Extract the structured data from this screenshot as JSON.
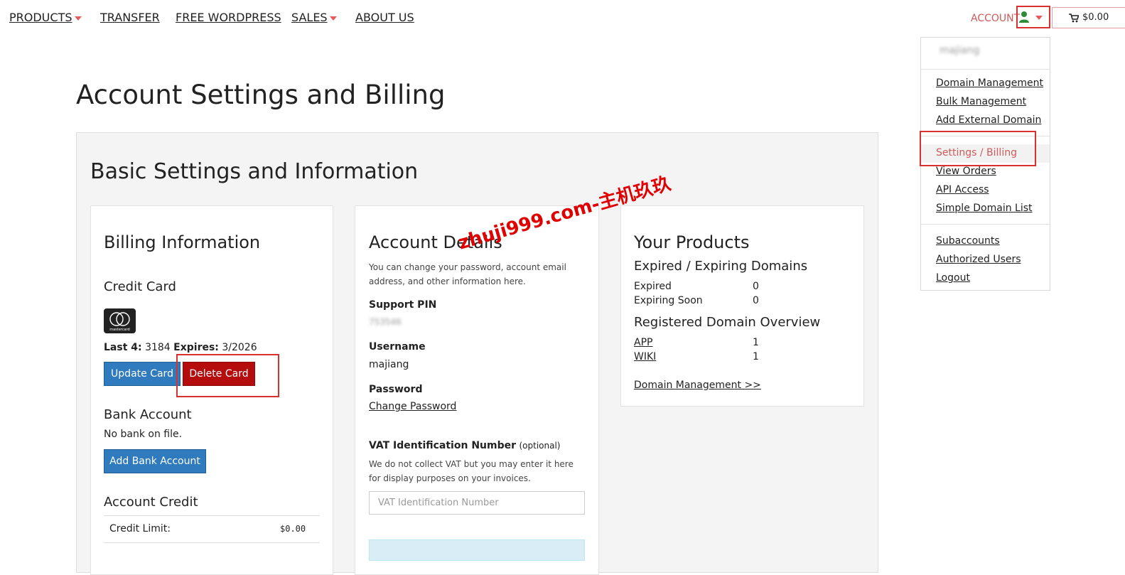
{
  "nav": {
    "items": [
      {
        "label": "PRODUCTS",
        "has_caret": true
      },
      {
        "label": "TRANSFER",
        "has_caret": false
      },
      {
        "label": "FREE WORDPRESS",
        "has_caret": false
      },
      {
        "label": "SALES",
        "has_caret": true
      },
      {
        "label": "ABOUT US",
        "has_caret": false
      }
    ],
    "account_label": "ACCOUNT",
    "cart_amount": "$0.00"
  },
  "dropdown": {
    "username_blurred": "majiang",
    "items": [
      "Domain Management",
      "Bulk Management",
      "Add External Domain",
      "Settings / Billing",
      "View Orders",
      "API Access",
      "Simple Domain List",
      "Subaccounts",
      "Authorized Users",
      "Logout"
    ]
  },
  "page": {
    "title": "Account Settings and Billing",
    "section_title": "Basic Settings and Information"
  },
  "billing": {
    "title": "Billing Information",
    "credit_card_heading": "Credit Card",
    "card_brand_text": "mastercard",
    "last4_label": "Last 4:",
    "last4_value": "3184",
    "expires_label": "Expires:",
    "expires_value": "3/2026",
    "update_button": "Update Card",
    "delete_button": "Delete Card",
    "bank_heading": "Bank Account",
    "bank_text": "No bank on file.",
    "add_bank_button": "Add Bank Account",
    "credit_heading": "Account Credit",
    "credit_limit_label": "Credit Limit:",
    "credit_limit_value": "$0.00"
  },
  "account": {
    "title": "Account Details",
    "description": "You can change your password, account email address, and other information here.",
    "pin_label": "Support PIN",
    "pin_value_blurred": "753546",
    "username_label": "Username",
    "username_value": "majiang",
    "password_label": "Password",
    "change_password": "Change Password",
    "vat_label": "VAT Identification Number",
    "vat_optional": "(optional)",
    "vat_help": "We do not collect VAT but you may enter it here for display purposes on your invoices.",
    "vat_placeholder": "VAT Identification Number"
  },
  "products": {
    "title": "Your Products",
    "expired_heading": "Expired / Expiring Domains",
    "expired_rows": [
      {
        "label": "Expired",
        "value": "0"
      },
      {
        "label": "Expiring Soon",
        "value": "0"
      }
    ],
    "registered_heading": "Registered Domain Overview",
    "registered_rows": [
      {
        "label": "APP",
        "value": "1"
      },
      {
        "label": "WIKI",
        "value": "1"
      }
    ],
    "domain_mgmt_link": "Domain Management >>"
  },
  "watermark": "zhuji999.com-主机玖玖",
  "colors": {
    "accent_red": "#d93030",
    "button_blue": "#2f7bbd",
    "button_red": "#b50d0d",
    "account_pink": "#d05a5a"
  }
}
